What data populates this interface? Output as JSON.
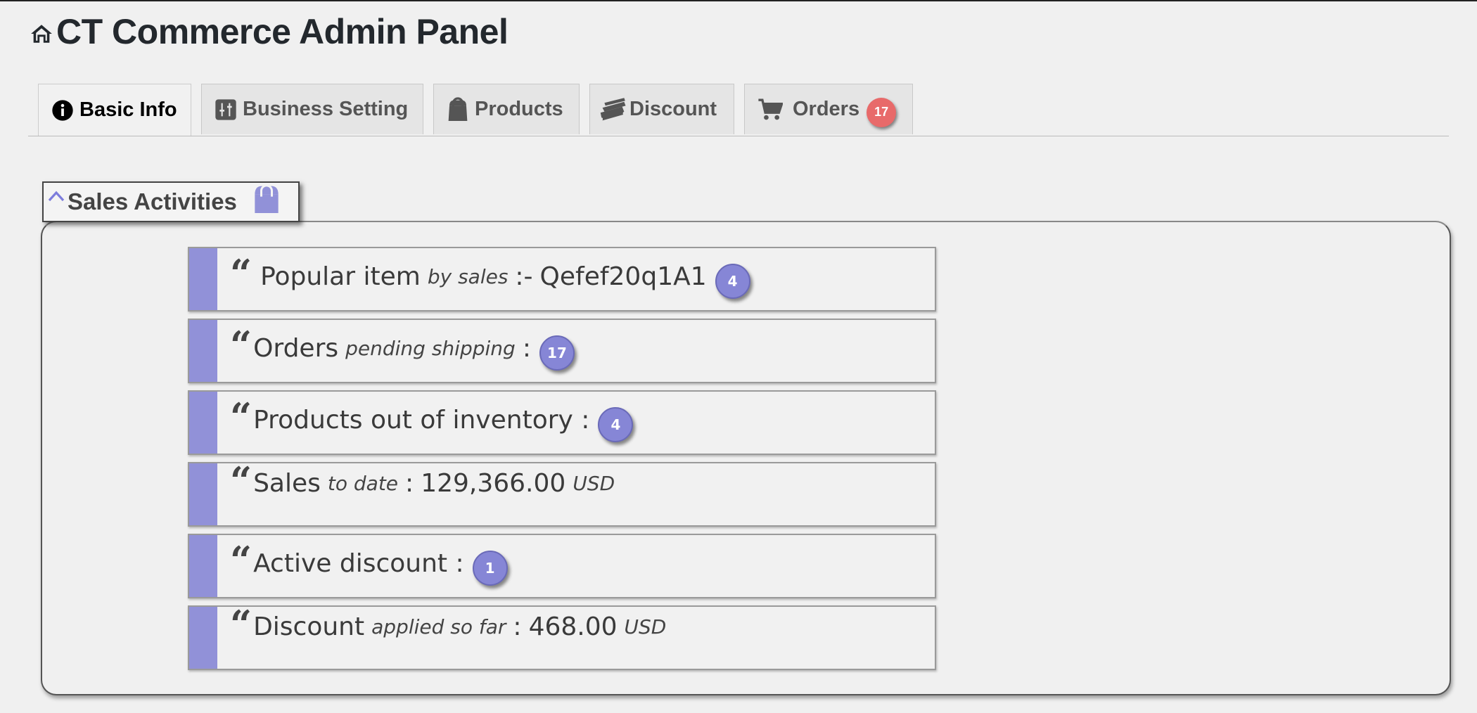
{
  "header": {
    "title": "CT Commerce Admin Panel"
  },
  "tabs": [
    {
      "label": "Basic Info",
      "icon": "info-icon"
    },
    {
      "label": "Business Setting",
      "icon": "settings-icon"
    },
    {
      "label": "Products",
      "icon": "bag-icon"
    },
    {
      "label": "Discount",
      "icon": "tickets-icon"
    },
    {
      "label": "Orders",
      "icon": "cart-icon",
      "badge": "17"
    }
  ],
  "colors": {
    "accent": "#9191d8",
    "badge_red": "#e86a6a"
  },
  "sales": {
    "legend": "Sales Activities",
    "popular": {
      "label": "Popular item",
      "qualifier": "by sales",
      "sep": ":-",
      "value": "Qefef20q1A1",
      "badge": "4"
    },
    "pending": {
      "label": "Orders",
      "qualifier": "pending shipping",
      "sep": ":",
      "badge": "17"
    },
    "inventory": {
      "label": "Products out of inventory :",
      "badge": "4"
    },
    "sales_to_date": {
      "label": "Sales",
      "qualifier": "to date",
      "sep": ":",
      "value": "129,366.00",
      "unit": "USD"
    },
    "active_discount": {
      "label": "Active discount :",
      "badge": "1"
    },
    "discount_applied": {
      "label": "Discount",
      "qualifier": "applied so far",
      "sep": ":",
      "value": "468.00",
      "unit": "USD"
    }
  }
}
